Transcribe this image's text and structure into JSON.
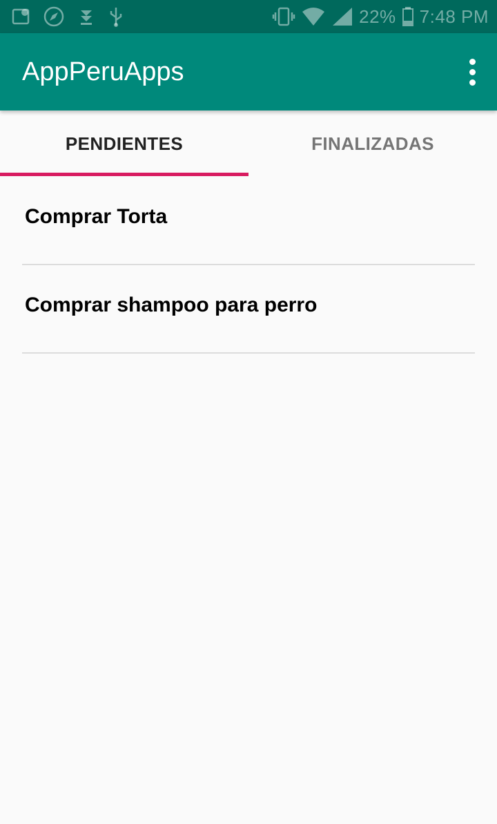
{
  "status_bar": {
    "icons": [
      "map-icon",
      "compass-icon",
      "download-icon",
      "usb-icon",
      "vibrate-icon",
      "wifi-icon",
      "signal-icon",
      "battery-icon"
    ],
    "battery": "22%",
    "time": "7:48 PM"
  },
  "app_bar": {
    "title": "AppPeruApps",
    "menu_icon": "more-vert-icon"
  },
  "tabs": [
    {
      "label": "PENDIENTES",
      "selected": true
    },
    {
      "label": "FINALIZADAS",
      "selected": false
    }
  ],
  "tasks": [
    {
      "title": "Comprar Torta"
    },
    {
      "title": "Comprar shampoo para perro"
    }
  ],
  "colors": {
    "status_bar": "#00695c",
    "app_bar": "#00897b",
    "tab_indicator": "#d81b60",
    "background": "#fafafa"
  }
}
